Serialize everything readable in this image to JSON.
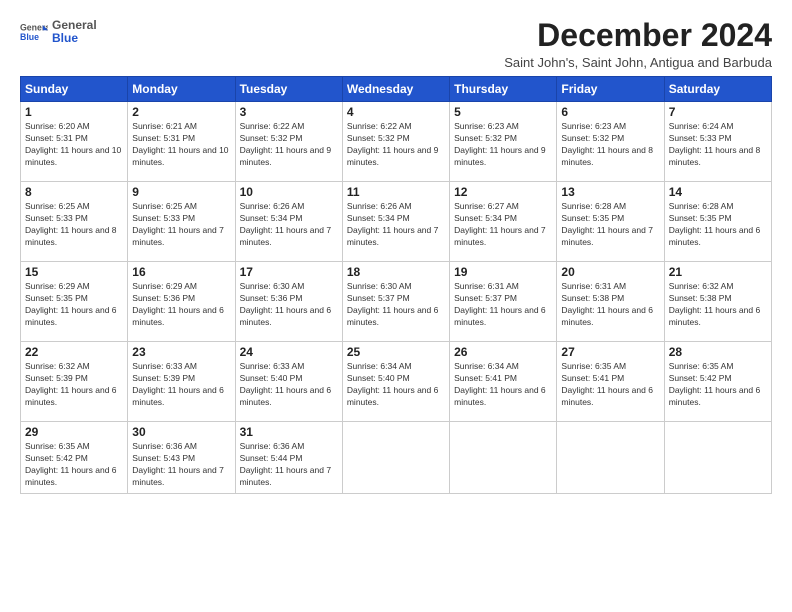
{
  "logo": {
    "general": "General",
    "blue": "Blue"
  },
  "title": "December 2024",
  "subtitle": "Saint John's, Saint John, Antigua and Barbuda",
  "days_header": [
    "Sunday",
    "Monday",
    "Tuesday",
    "Wednesday",
    "Thursday",
    "Friday",
    "Saturday"
  ],
  "weeks": [
    [
      {
        "day": "1",
        "sunrise": "6:20 AM",
        "sunset": "5:31 PM",
        "daylight": "11 hours and 10 minutes."
      },
      {
        "day": "2",
        "sunrise": "6:21 AM",
        "sunset": "5:31 PM",
        "daylight": "11 hours and 10 minutes."
      },
      {
        "day": "3",
        "sunrise": "6:22 AM",
        "sunset": "5:32 PM",
        "daylight": "11 hours and 9 minutes."
      },
      {
        "day": "4",
        "sunrise": "6:22 AM",
        "sunset": "5:32 PM",
        "daylight": "11 hours and 9 minutes."
      },
      {
        "day": "5",
        "sunrise": "6:23 AM",
        "sunset": "5:32 PM",
        "daylight": "11 hours and 9 minutes."
      },
      {
        "day": "6",
        "sunrise": "6:23 AM",
        "sunset": "5:32 PM",
        "daylight": "11 hours and 8 minutes."
      },
      {
        "day": "7",
        "sunrise": "6:24 AM",
        "sunset": "5:33 PM",
        "daylight": "11 hours and 8 minutes."
      }
    ],
    [
      {
        "day": "8",
        "sunrise": "6:25 AM",
        "sunset": "5:33 PM",
        "daylight": "11 hours and 8 minutes."
      },
      {
        "day": "9",
        "sunrise": "6:25 AM",
        "sunset": "5:33 PM",
        "daylight": "11 hours and 7 minutes."
      },
      {
        "day": "10",
        "sunrise": "6:26 AM",
        "sunset": "5:34 PM",
        "daylight": "11 hours and 7 minutes."
      },
      {
        "day": "11",
        "sunrise": "6:26 AM",
        "sunset": "5:34 PM",
        "daylight": "11 hours and 7 minutes."
      },
      {
        "day": "12",
        "sunrise": "6:27 AM",
        "sunset": "5:34 PM",
        "daylight": "11 hours and 7 minutes."
      },
      {
        "day": "13",
        "sunrise": "6:28 AM",
        "sunset": "5:35 PM",
        "daylight": "11 hours and 7 minutes."
      },
      {
        "day": "14",
        "sunrise": "6:28 AM",
        "sunset": "5:35 PM",
        "daylight": "11 hours and 6 minutes."
      }
    ],
    [
      {
        "day": "15",
        "sunrise": "6:29 AM",
        "sunset": "5:35 PM",
        "daylight": "11 hours and 6 minutes."
      },
      {
        "day": "16",
        "sunrise": "6:29 AM",
        "sunset": "5:36 PM",
        "daylight": "11 hours and 6 minutes."
      },
      {
        "day": "17",
        "sunrise": "6:30 AM",
        "sunset": "5:36 PM",
        "daylight": "11 hours and 6 minutes."
      },
      {
        "day": "18",
        "sunrise": "6:30 AM",
        "sunset": "5:37 PM",
        "daylight": "11 hours and 6 minutes."
      },
      {
        "day": "19",
        "sunrise": "6:31 AM",
        "sunset": "5:37 PM",
        "daylight": "11 hours and 6 minutes."
      },
      {
        "day": "20",
        "sunrise": "6:31 AM",
        "sunset": "5:38 PM",
        "daylight": "11 hours and 6 minutes."
      },
      {
        "day": "21",
        "sunrise": "6:32 AM",
        "sunset": "5:38 PM",
        "daylight": "11 hours and 6 minutes."
      }
    ],
    [
      {
        "day": "22",
        "sunrise": "6:32 AM",
        "sunset": "5:39 PM",
        "daylight": "11 hours and 6 minutes."
      },
      {
        "day": "23",
        "sunrise": "6:33 AM",
        "sunset": "5:39 PM",
        "daylight": "11 hours and 6 minutes."
      },
      {
        "day": "24",
        "sunrise": "6:33 AM",
        "sunset": "5:40 PM",
        "daylight": "11 hours and 6 minutes."
      },
      {
        "day": "25",
        "sunrise": "6:34 AM",
        "sunset": "5:40 PM",
        "daylight": "11 hours and 6 minutes."
      },
      {
        "day": "26",
        "sunrise": "6:34 AM",
        "sunset": "5:41 PM",
        "daylight": "11 hours and 6 minutes."
      },
      {
        "day": "27",
        "sunrise": "6:35 AM",
        "sunset": "5:41 PM",
        "daylight": "11 hours and 6 minutes."
      },
      {
        "day": "28",
        "sunrise": "6:35 AM",
        "sunset": "5:42 PM",
        "daylight": "11 hours and 6 minutes."
      }
    ],
    [
      {
        "day": "29",
        "sunrise": "6:35 AM",
        "sunset": "5:42 PM",
        "daylight": "11 hours and 6 minutes."
      },
      {
        "day": "30",
        "sunrise": "6:36 AM",
        "sunset": "5:43 PM",
        "daylight": "11 hours and 7 minutes."
      },
      {
        "day": "31",
        "sunrise": "6:36 AM",
        "sunset": "5:44 PM",
        "daylight": "11 hours and 7 minutes."
      },
      null,
      null,
      null,
      null
    ]
  ],
  "labels": {
    "sunrise": "Sunrise:",
    "sunset": "Sunset:",
    "daylight": "Daylight:"
  }
}
